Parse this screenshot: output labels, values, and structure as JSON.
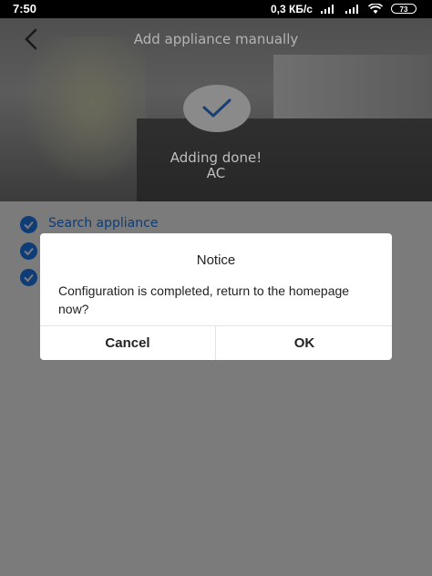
{
  "status_bar": {
    "time": "7:50",
    "network_speed": "0,3 КБ/с",
    "battery": "73"
  },
  "header": {
    "title": "Add appliance manually"
  },
  "result": {
    "line1": "Adding done!",
    "line2": "AC"
  },
  "steps": [
    {
      "label": "Search appliance"
    },
    {
      "label": ""
    },
    {
      "label": ""
    }
  ],
  "dialog": {
    "title": "Notice",
    "message": "Configuration is completed, return to the homepage now?",
    "cancel_label": "Cancel",
    "ok_label": "OK"
  },
  "colors": {
    "accent": "#0e3c76",
    "overlay": "#777777"
  }
}
